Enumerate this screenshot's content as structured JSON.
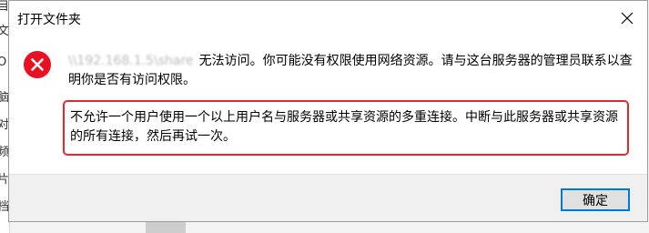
{
  "dialog": {
    "title": "打开文件夹",
    "server_path": "\\\\192.168.1.5\\share",
    "main_message": "无法访问。你可能没有权限使用网络资源。请与这台服务器的管理员联系以查明你是否有访问权限。",
    "detail_message": "不允许一个用户使用一个以上用户名与服务器或共享资源的多重连接。中断与此服务器或共享资源的所有连接，然后再试一次。",
    "ok_label": "确定"
  },
  "background": {
    "left_edge_chars": [
      "目",
      "文",
      "O",
      "脑",
      "对",
      "频",
      "片",
      "档"
    ]
  },
  "colors": {
    "error_red": "#e81123",
    "highlight_border": "#e8262b",
    "button_focus": "#0078d7"
  },
  "icons": {
    "close": "close-icon",
    "error": "error-circle-icon"
  }
}
